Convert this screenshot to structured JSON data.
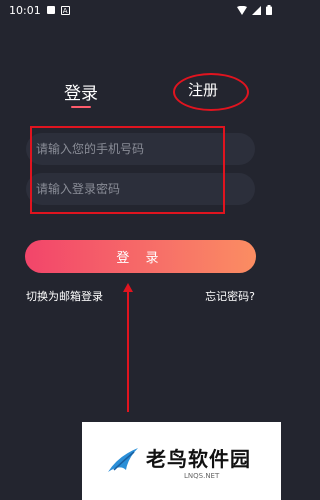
{
  "status_bar": {
    "time": "10:01",
    "notification_badge": "A"
  },
  "tabs": {
    "login": "登录",
    "register": "注册"
  },
  "form": {
    "phone_placeholder": "请输入您的手机号码",
    "password_placeholder": "请输入登录密码",
    "login_button": "登 录"
  },
  "links": {
    "switch_email": "切换为邮箱登录",
    "forgot_password": "忘记密码?"
  },
  "watermark": {
    "title": "老鸟软件园",
    "subtitle": "LNQS.NET"
  },
  "colors": {
    "background": "#23252f",
    "accent": "#ff5c6c",
    "annotation": "#e0141f"
  }
}
